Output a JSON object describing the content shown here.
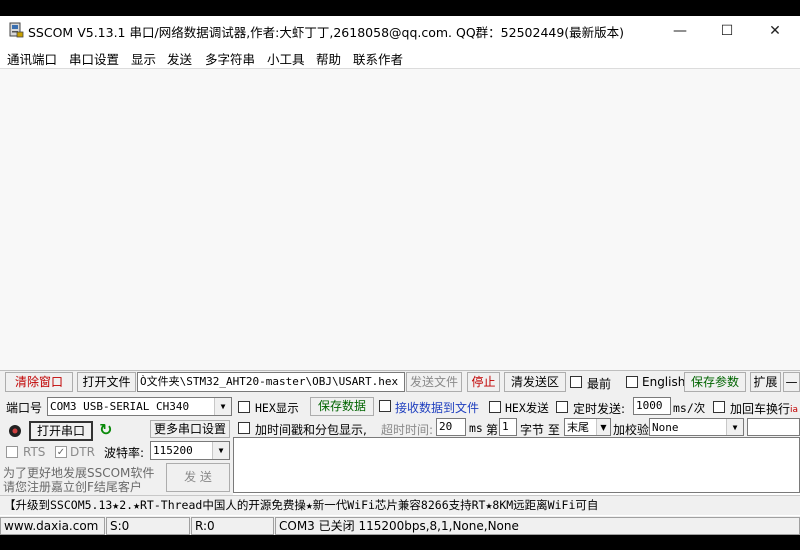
{
  "window": {
    "title": "SSCOM V5.13.1 串口/网络数据调试器,作者:大虾丁丁,2618058@qq.com. QQ群：52502449(最新版本)",
    "minimize": "—",
    "maximize": "☐",
    "close": "✕"
  },
  "menu": [
    "通讯端口",
    "串口设置",
    "显示",
    "发送",
    "多字符串",
    "小工具",
    "帮助",
    "联系作者"
  ],
  "toolbar": {
    "clear_window": "清除窗口",
    "open_file": "打开文件",
    "file_path": "Ò文件夹\\STM32_AHT20-master\\OBJ\\USART.hex",
    "send_file": "发送文件",
    "stop": "停止",
    "clear_send": "清发送区",
    "topmost": "最前",
    "english": "English",
    "save_params": "保存参数",
    "expand": "扩展",
    "collapse": "—"
  },
  "port": {
    "label": "端口号",
    "value": "COM3 USB-SERIAL CH340",
    "open_button": "打开串口",
    "more_settings": "更多串口设置",
    "rts": "RTS",
    "dtr": "DTR",
    "baud_label": "波特率:",
    "baud_value": "115200"
  },
  "options": {
    "hex_display": "HEX显示",
    "save_data": "保存数据",
    "recv_to_file": "接收数据到文件",
    "hex_send": "HEX发送",
    "timed_send": "定时发送:",
    "timed_ms": "1000",
    "ms_per": "ms/次",
    "add_crlf": "加回车换行",
    "timestamp": "加时间戳和分包显示,",
    "timeout_label": "超时时间:",
    "timeout_value": "20",
    "ms": "ms",
    "byte_prefix": "第",
    "byte_value": "1",
    "byte_label": "字节 至",
    "tail_value": "末尾",
    "checksum_label": "加校验",
    "checksum_value": "None",
    "side_fragment": "ia"
  },
  "promo": {
    "line1": "为了更好地发展SSCOM软件",
    "line2": "请您注册嘉立创F结尾客户"
  },
  "send_button": "发  送",
  "ticker": "【升级到SSCOM5.13★2.★RT-Thread中国人的开源免费操★新一代WiFi芯片兼容8266支持RT★8KM远距离WiFi可自",
  "status": {
    "website": "www.daxia.com",
    "sent": "S:0",
    "received": "R:0",
    "port_state": "COM3 已关闭  115200bps,8,1,None,None"
  }
}
